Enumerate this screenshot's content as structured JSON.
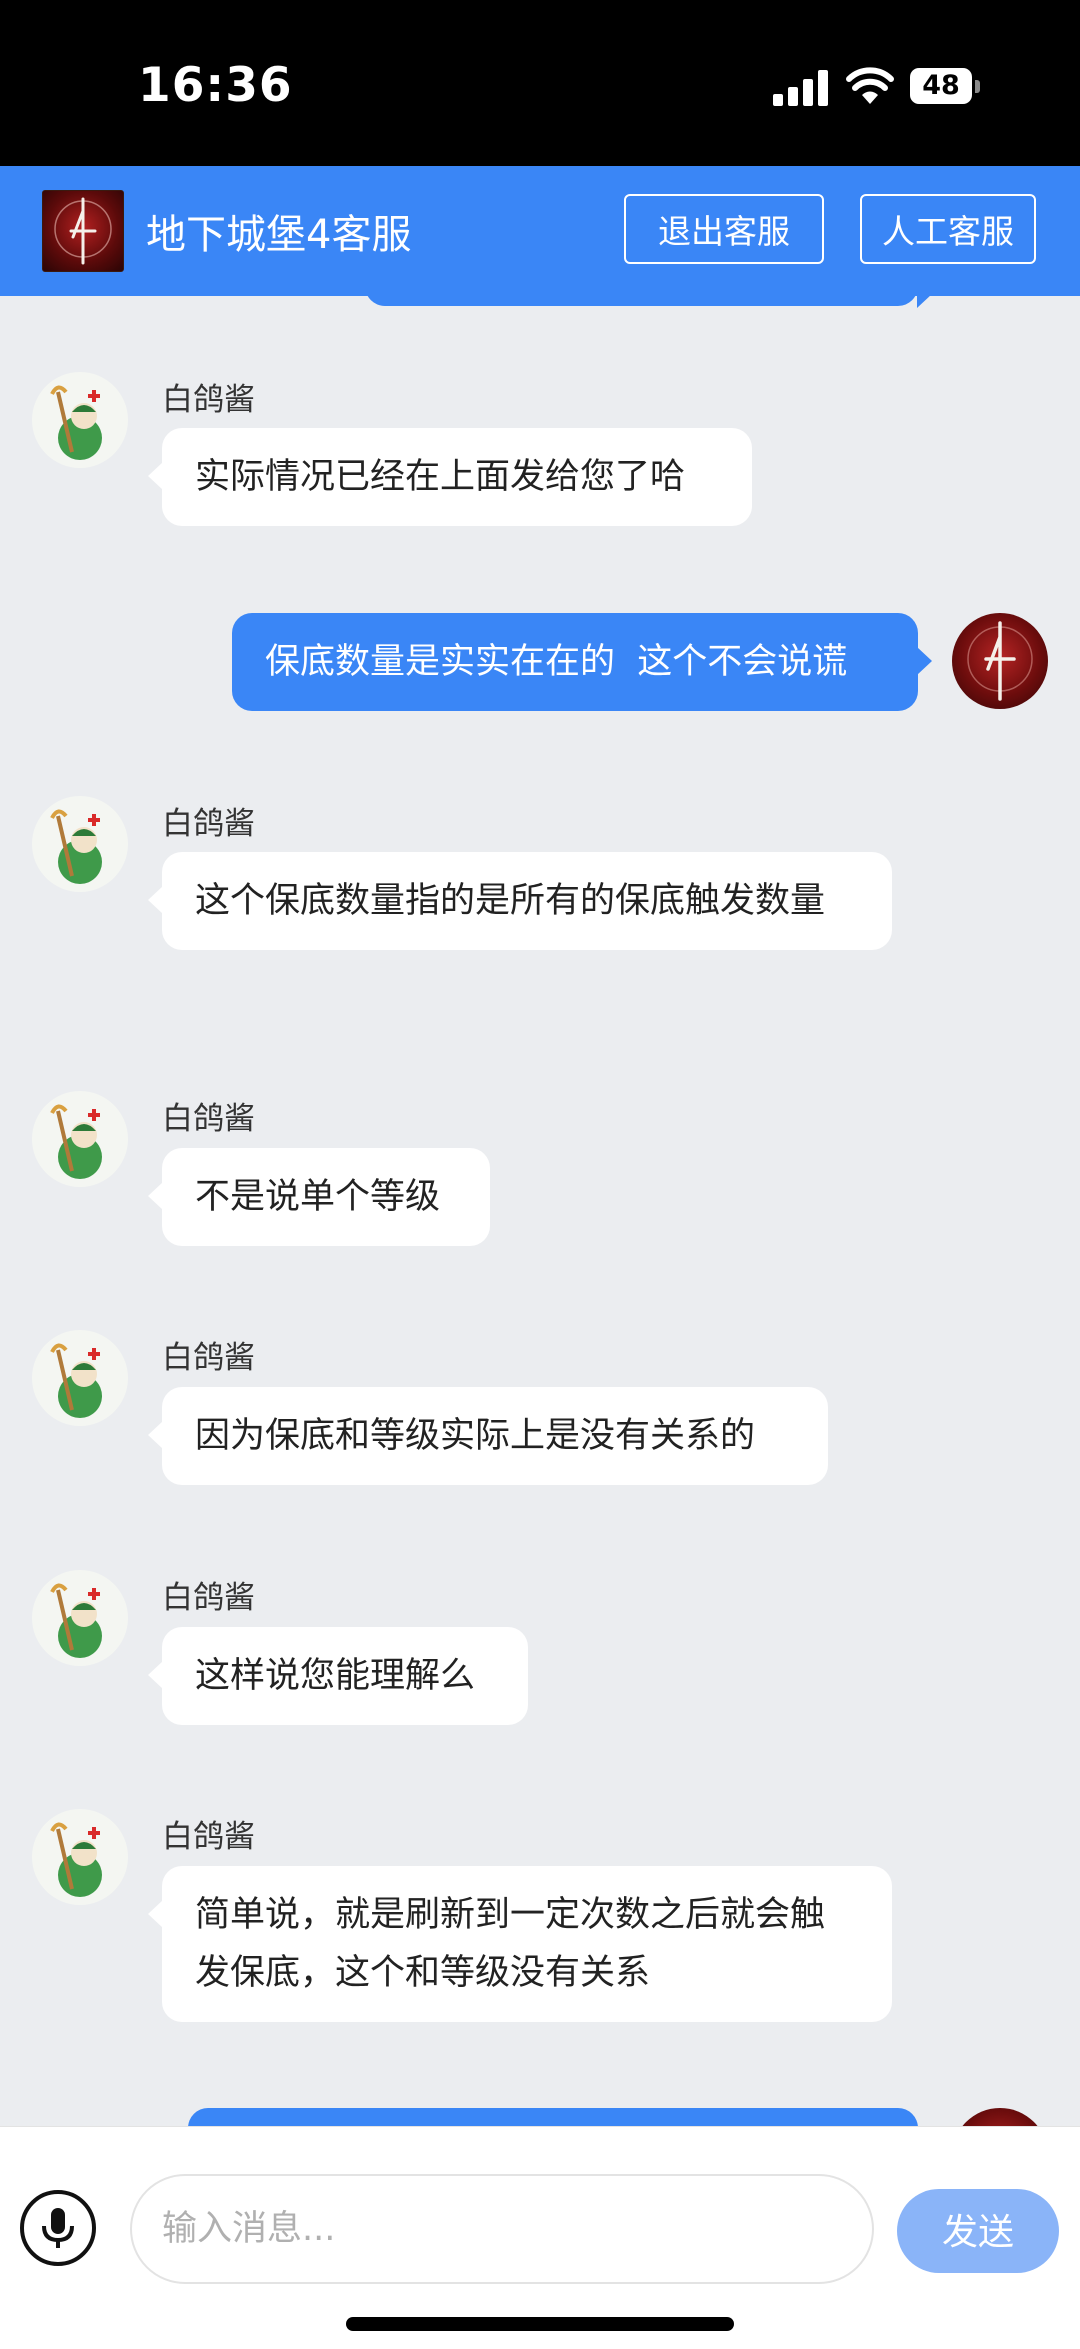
{
  "status_bar": {
    "time": "16:36",
    "battery": "48"
  },
  "header": {
    "title": "地下城堡4客服",
    "exit_button": "退出客服",
    "human_button": "人工客服"
  },
  "messages": [
    {
      "sender": "白鸽酱",
      "text": "实际情况已经在上面发给您了哈"
    },
    {
      "text": "保底数量是实实在在的  这个不会说谎"
    },
    {
      "sender": "白鸽酱",
      "text": "这个保底数量指的是所有的保底触发数量"
    },
    {
      "sender": "白鸽酱",
      "text": "不是说单个等级"
    },
    {
      "sender": "白鸽酱",
      "text": "因为保底和等级实际上是没有关系的"
    },
    {
      "sender": "白鸽酱",
      "text": "这样说您能理解么"
    },
    {
      "sender": "白鸽酱",
      "text": "简单说，就是刷新到一定次数之后就会触发保底，这个和等级没有关系"
    }
  ],
  "input": {
    "placeholder": "输入消息...",
    "send_label": "发送"
  },
  "colors": {
    "accent": "#3a86f6",
    "send_disabled": "#8ab4f8",
    "background": "#ebedf0"
  },
  "icons": [
    "game-logo-icon",
    "agent-avatar-icon",
    "user-avatar-icon",
    "microphone-icon"
  ]
}
